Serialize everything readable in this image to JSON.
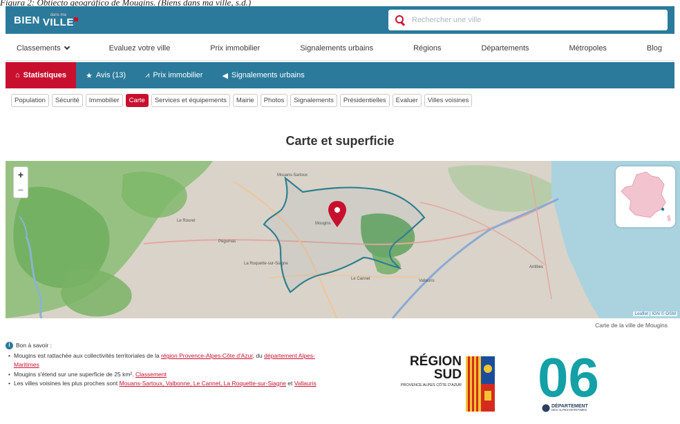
{
  "caption": "Figura 2: Obtiecto geográfico de Mougins. (Biens dans ma ville, s.d.)",
  "header": {
    "logo_bien": "BIEN",
    "logo_dans": "dans ma",
    "logo_ville": "VILLE",
    "search_placeholder": "Rechercher une ville"
  },
  "main_nav": [
    "Classements",
    "Evaluez votre ville",
    "Prix immobilier",
    "Signalements urbains",
    "Régions",
    "Départements",
    "Métropoles",
    "Blog"
  ],
  "sub_nav": [
    {
      "icon": "home-icon",
      "label": "Statistiques",
      "active": true
    },
    {
      "icon": "star-icon",
      "label": "Avis (13)",
      "active": false
    },
    {
      "icon": "chart-icon",
      "label": "Prix immobilier",
      "active": false
    },
    {
      "icon": "megaphone-icon",
      "label": "Signalements urbains",
      "active": false
    }
  ],
  "pills": [
    "Population",
    "Sécurité",
    "Immobilier",
    "Carte",
    "Services et équipements",
    "Mairie",
    "Photos",
    "Signalements",
    "Présidentielles",
    "Evaluer",
    "Villes voisines"
  ],
  "active_pill": "Carte",
  "section_title": "Carte et superficie",
  "map": {
    "zoom_in": "+",
    "zoom_out": "−",
    "attribution": "Leaflet | IGN © OSM",
    "town_label": "Mougins",
    "labels": [
      "Mouans-Sartoux",
      "Le Cannet",
      "Vallauris",
      "Antibes",
      "Pégomas",
      "Le Rouret",
      "La Roquette-sur-Siagne"
    ]
  },
  "map_caption": "Carte de la ville de Mougins",
  "info": {
    "head": "Bon à savoir :",
    "lines": [
      {
        "pre": "Mougins est rattachée aux collectivités territoriales de la",
        "link1": "région Provence-Alpes-Côte d'Azur",
        "mid": ", du",
        "link2": "département Alpes-Maritimes",
        "post": ""
      },
      {
        "pre": "Mougins s'étend sur une superficie de 25 km².",
        "link1": "Classement",
        "mid": "",
        "link2": "",
        "post": ""
      },
      {
        "pre": "Les villes voisines les plus proches sont",
        "link1": "Mouans-Sartoux, Valbonne, Le Cannet, La Roquette-sur-Siagne",
        "mid": " et ",
        "link2": "Vallauris",
        "post": ""
      }
    ]
  },
  "logo_region": {
    "line1": "RÉGION",
    "line2": "SUD",
    "sub": "PROVENCE ALPES CÔTE D'AZUR"
  },
  "logo_dept": {
    "big": "06",
    "line1": "DÉPARTEMENT",
    "line2": "DES ALPES-MARITIMES"
  },
  "colors": {
    "brand_blue": "#2b7a9b",
    "accent_red": "#c8102e",
    "dept_teal": "#13a0a6"
  }
}
